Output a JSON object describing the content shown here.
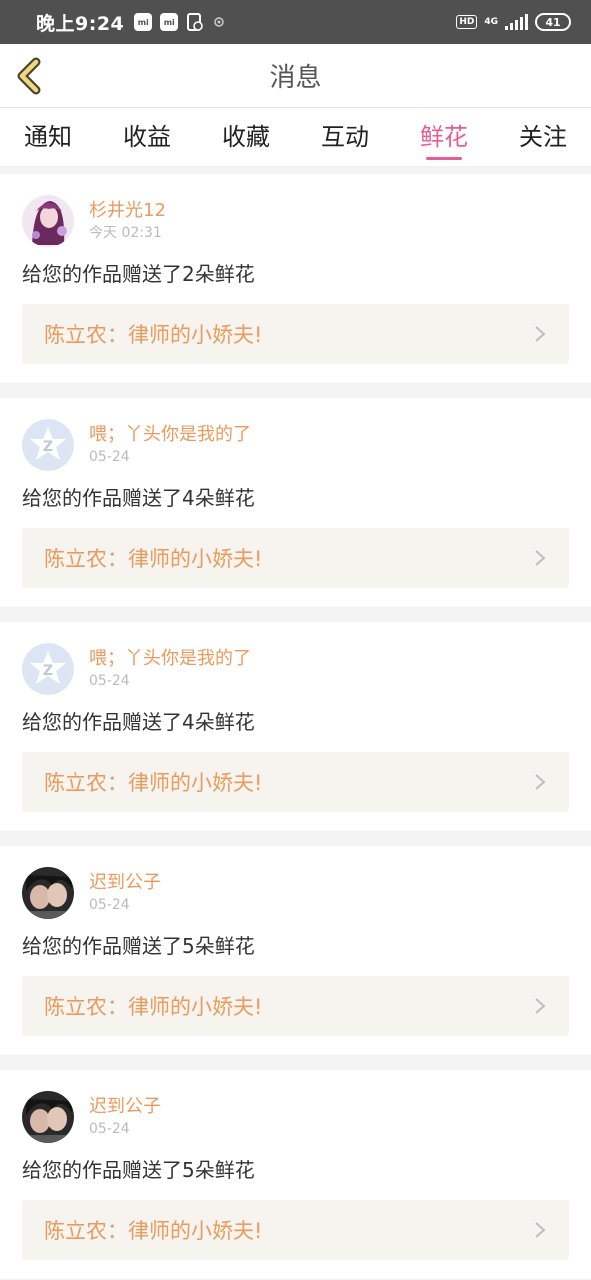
{
  "status_bar": {
    "time": "晚上9:24",
    "network": "4G",
    "hd": "HD",
    "battery": "41",
    "mi_icon_text": "mi"
  },
  "header": {
    "title": "消息"
  },
  "tabs": [
    {
      "label": "通知",
      "active": false
    },
    {
      "label": "收益",
      "active": false
    },
    {
      "label": "收藏",
      "active": false
    },
    {
      "label": "互动",
      "active": false
    },
    {
      "label": "鲜花",
      "active": true
    },
    {
      "label": "关注",
      "active": false
    }
  ],
  "colors": {
    "accent": "#e75d98",
    "name": "#ec9a5e",
    "link_bg": "#f5f4ee"
  },
  "messages": [
    {
      "user": "杉井光12",
      "time": "今天 02:31",
      "text": "给您的作品赠送了2朵鲜花",
      "work": "陈立农：律师的小娇夫!",
      "avatar": "anime-avatar"
    },
    {
      "user": "喂；丫头你是我的了",
      "time": "05-24",
      "text": "给您的作品赠送了4朵鲜花",
      "work": "陈立农：律师的小娇夫!",
      "avatar": "qq-default-avatar"
    },
    {
      "user": "喂；丫头你是我的了",
      "time": "05-24",
      "text": "给您的作品赠送了4朵鲜花",
      "work": "陈立农：律师的小娇夫!",
      "avatar": "qq-default-avatar"
    },
    {
      "user": "迟到公子",
      "time": "05-24",
      "text": "给您的作品赠送了5朵鲜花",
      "work": "陈立农：律师的小娇夫!",
      "avatar": "photo-avatar"
    },
    {
      "user": "迟到公子",
      "time": "05-24",
      "text": "给您的作品赠送了5朵鲜花",
      "work": "陈立农：律师的小娇夫!",
      "avatar": "photo-avatar"
    }
  ]
}
